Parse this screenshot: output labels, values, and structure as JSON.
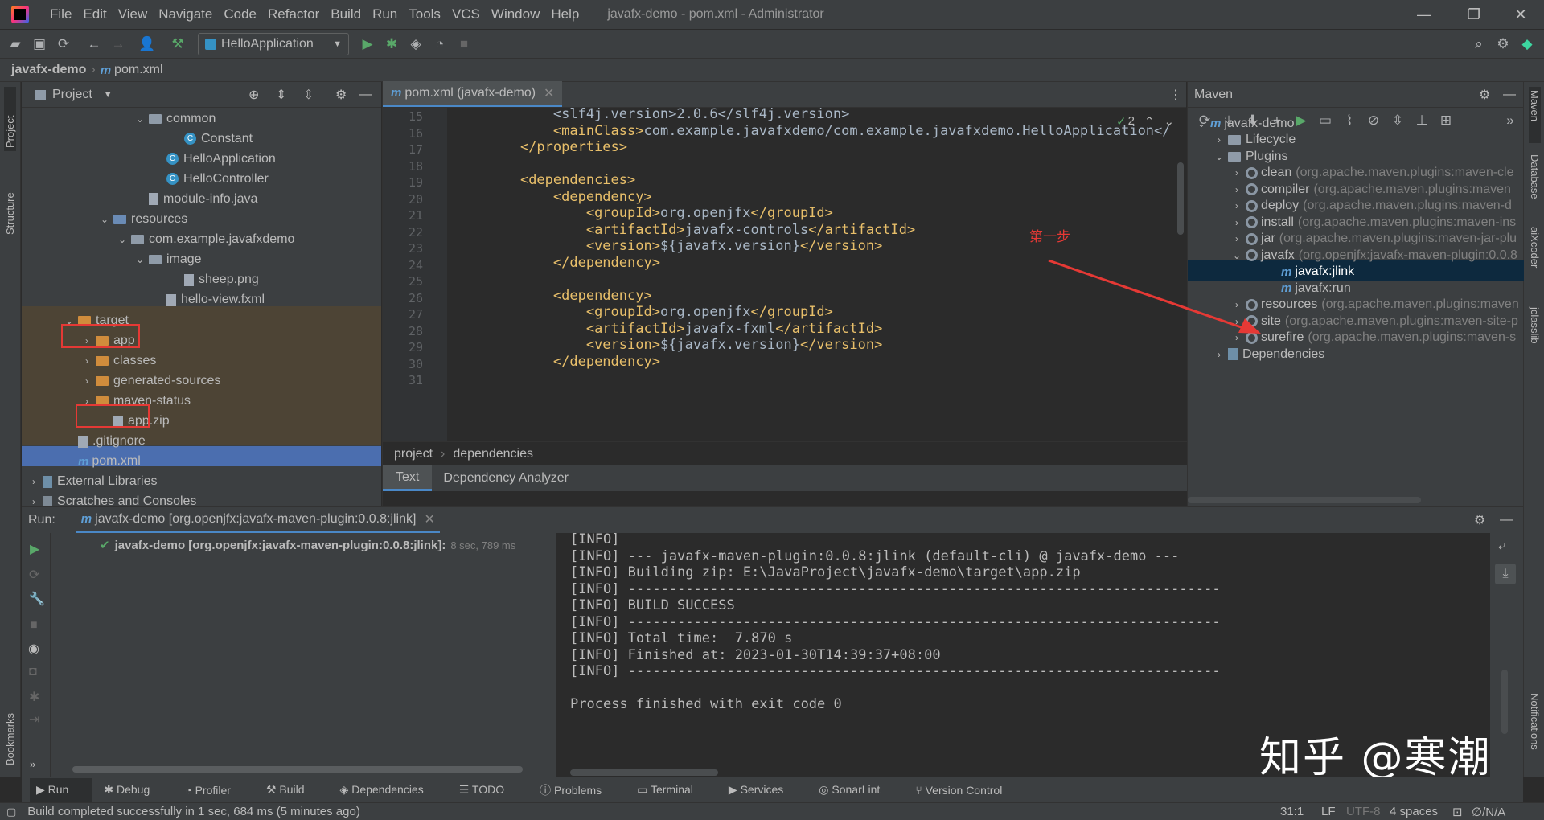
{
  "window": {
    "title": "javafx-demo - pom.xml - Administrator",
    "menu": [
      "File",
      "Edit",
      "View",
      "Navigate",
      "Code",
      "Refactor",
      "Build",
      "Run",
      "Tools",
      "VCS",
      "Window",
      "Help"
    ]
  },
  "toolbar": {
    "run_config": "HelloApplication"
  },
  "navbar": {
    "project": "javafx-demo",
    "file": "pom.xml"
  },
  "project_panel": {
    "title": "Project",
    "tree": [
      {
        "label": "common",
        "indent": 6,
        "icon": "folder",
        "arrow": "v"
      },
      {
        "label": "Constant",
        "indent": 8,
        "icon": "class"
      },
      {
        "label": "HelloApplication",
        "indent": 7,
        "icon": "class"
      },
      {
        "label": "HelloController",
        "indent": 7,
        "icon": "class"
      },
      {
        "label": "module-info.java",
        "indent": 6,
        "icon": "file"
      },
      {
        "label": "resources",
        "indent": 4,
        "icon": "folder-res",
        "arrow": "v"
      },
      {
        "label": "com.example.javafxdemo",
        "indent": 5,
        "icon": "folder",
        "arrow": "v"
      },
      {
        "label": "image",
        "indent": 6,
        "icon": "folder",
        "arrow": "v"
      },
      {
        "label": "sheep.png",
        "indent": 8,
        "icon": "file"
      },
      {
        "label": "hello-view.fxml",
        "indent": 7,
        "icon": "file"
      },
      {
        "label": "target",
        "indent": 2,
        "icon": "folder-orange",
        "arrow": "v"
      },
      {
        "label": "app",
        "indent": 3,
        "icon": "folder-orange",
        "arrow": ">"
      },
      {
        "label": "classes",
        "indent": 3,
        "icon": "folder-orange",
        "arrow": ">"
      },
      {
        "label": "generated-sources",
        "indent": 3,
        "icon": "folder-orange",
        "arrow": ">"
      },
      {
        "label": "maven-status",
        "indent": 3,
        "icon": "folder-orange",
        "arrow": ">"
      },
      {
        "label": "app.zip",
        "indent": 4,
        "icon": "file"
      },
      {
        "label": ".gitignore",
        "indent": 2,
        "icon": "file"
      },
      {
        "label": "pom.xml",
        "indent": 2,
        "icon": "maven"
      },
      {
        "label": "External Libraries",
        "indent": 0,
        "icon": "lib",
        "arrow": ">"
      },
      {
        "label": "Scratches and Consoles",
        "indent": 0,
        "icon": "scratch",
        "arrow": ">"
      }
    ]
  },
  "editor": {
    "tab": "pom.xml (javafx-demo)",
    "inspection_count": "2",
    "lines": [
      {
        "n": "15",
        "code": "        <slf4j.version>2.0.6</slf4j.version>"
      },
      {
        "n": "16",
        "code": "        <mainClass>com.example.javafxdemo/com.example.javafxdemo.HelloApplication</"
      },
      {
        "n": "17",
        "code": "    </properties>"
      },
      {
        "n": "18",
        "code": ""
      },
      {
        "n": "19",
        "code": "    <dependencies>"
      },
      {
        "n": "20",
        "code": "        <dependency>"
      },
      {
        "n": "21",
        "code": "            <groupId>org.openjfx</groupId>"
      },
      {
        "n": "22",
        "code": "            <artifactId>javafx-controls</artifactId>"
      },
      {
        "n": "23",
        "code": "            <version>${javafx.version}</version>"
      },
      {
        "n": "24",
        "code": "        </dependency>"
      },
      {
        "n": "25",
        "code": ""
      },
      {
        "n": "26",
        "code": "        <dependency>"
      },
      {
        "n": "27",
        "code": "            <groupId>org.openjfx</groupId>"
      },
      {
        "n": "28",
        "code": "            <artifactId>javafx-fxml</artifactId>"
      },
      {
        "n": "29",
        "code": "            <version>${javafx.version}</version>"
      },
      {
        "n": "30",
        "code": "        </dependency>"
      },
      {
        "n": "31",
        "code": ""
      }
    ],
    "breadcrumb": [
      "project",
      "dependencies"
    ],
    "bottom_tabs": [
      "Text",
      "Dependency Analyzer"
    ]
  },
  "maven_panel": {
    "title": "Maven",
    "tree": [
      {
        "label": "javafx-demo",
        "gray": "",
        "indent": 0,
        "arrow": "v",
        "icon": "maven"
      },
      {
        "label": "Lifecycle",
        "gray": "",
        "indent": 1,
        "arrow": ">",
        "icon": "folder"
      },
      {
        "label": "Plugins",
        "gray": "",
        "indent": 1,
        "arrow": "v",
        "icon": "folder"
      },
      {
        "label": "clean",
        "gray": "(org.apache.maven.plugins:maven-cle",
        "indent": 2,
        "arrow": ">",
        "icon": "gear"
      },
      {
        "label": "compiler",
        "gray": "(org.apache.maven.plugins:maven",
        "indent": 2,
        "arrow": ">",
        "icon": "gear"
      },
      {
        "label": "deploy",
        "gray": "(org.apache.maven.plugins:maven-d",
        "indent": 2,
        "arrow": ">",
        "icon": "gear"
      },
      {
        "label": "install",
        "gray": "(org.apache.maven.plugins:maven-ins",
        "indent": 2,
        "arrow": ">",
        "icon": "gear"
      },
      {
        "label": "jar",
        "gray": "(org.apache.maven.plugins:maven-jar-plu",
        "indent": 2,
        "arrow": ">",
        "icon": "gear"
      },
      {
        "label": "javafx",
        "gray": "(org.openjfx:javafx-maven-plugin:0.0.8",
        "indent": 2,
        "arrow": "v",
        "icon": "gear"
      },
      {
        "label": "javafx:jlink",
        "gray": "",
        "indent": 4,
        "arrow": "",
        "icon": "goal",
        "selected": true
      },
      {
        "label": "javafx:run",
        "gray": "",
        "indent": 4,
        "arrow": "",
        "icon": "goal"
      },
      {
        "label": "resources",
        "gray": "(org.apache.maven.plugins:maven",
        "indent": 2,
        "arrow": ">",
        "icon": "gear"
      },
      {
        "label": "site",
        "gray": "(org.apache.maven.plugins:maven-site-p",
        "indent": 2,
        "arrow": ">",
        "icon": "gear"
      },
      {
        "label": "surefire",
        "gray": "(org.apache.maven.plugins:maven-s",
        "indent": 2,
        "arrow": ">",
        "icon": "gear"
      },
      {
        "label": "Dependencies",
        "gray": "",
        "indent": 1,
        "arrow": ">",
        "icon": "lib"
      }
    ]
  },
  "annotation": "第一步",
  "run_panel": {
    "label": "Run:",
    "tab": "javafx-demo [org.openjfx:javafx-maven-plugin:0.0.8:jlink]",
    "tree_item": "javafx-demo [org.openjfx:javafx-maven-plugin:0.0.8:jlink]:",
    "tree_time": "8 sec, 789 ms",
    "console": [
      "[INFO]",
      "[INFO] --- javafx-maven-plugin:0.0.8:jlink (default-cli) @ javafx-demo ---",
      "[INFO] Building zip: E:\\JavaProject\\javafx-demo\\target\\app.zip",
      "[INFO] ------------------------------------------------------------------------",
      "[INFO] BUILD SUCCESS",
      "[INFO] ------------------------------------------------------------------------",
      "[INFO] Total time:  7.870 s",
      "[INFO] Finished at: 2023-01-30T14:39:37+08:00",
      "[INFO] ------------------------------------------------------------------------",
      "",
      "Process finished with exit code 0"
    ]
  },
  "bottom_tabs": [
    "Run",
    "Debug",
    "Profiler",
    "Build",
    "Dependencies",
    "TODO",
    "Problems",
    "Terminal",
    "Services",
    "SonarLint",
    "Version Control"
  ],
  "status": {
    "message": "Build completed successfully in 1 sec, 684 ms (5 minutes ago)",
    "position": "31:1",
    "line_sep": "LF",
    "encoding": "UTF-8",
    "indent": "4 spaces",
    "vcs": "∅/N/A"
  },
  "side_tabs_left": [
    "Project",
    "Structure",
    "Bookmarks"
  ],
  "side_tabs_right": [
    "Maven",
    "Database",
    "aiXcoder",
    "jclasslib",
    "Notifications"
  ],
  "watermark": "知乎 @寒潮",
  "colors": {
    "accent": "#4a88c7",
    "selection": "#4b6eaf",
    "annotation": "#e53935",
    "xml_tag": "#e8bf6a"
  }
}
